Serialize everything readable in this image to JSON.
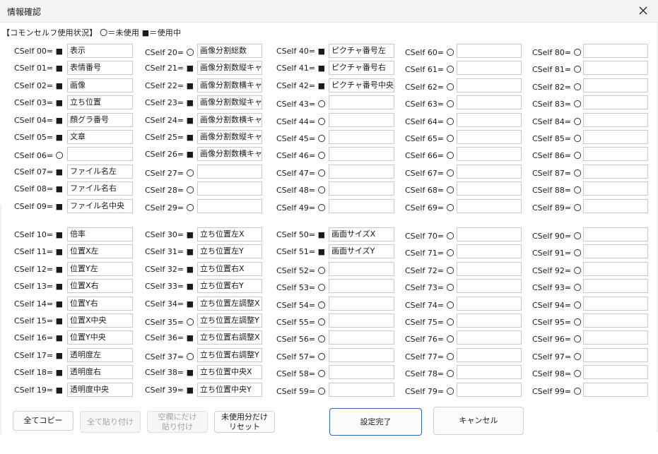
{
  "window": {
    "title": "情報確認",
    "close_icon": "close-icon"
  },
  "legend": "【コモンセルフ使用状況】 〇＝未使用 ■＝使用中",
  "slots": [
    {
      "label": "CSelf 00= ■",
      "value": "表示"
    },
    {
      "label": "CSelf 01= ■",
      "value": "表情番号"
    },
    {
      "label": "CSelf 02= ■",
      "value": "画像"
    },
    {
      "label": "CSelf 03= ■",
      "value": "立ち位置"
    },
    {
      "label": "CSelf 04= ■",
      "value": "顔グラ番号"
    },
    {
      "label": "CSelf 05= ■",
      "value": "文章"
    },
    {
      "label": "CSelf 06= 〇",
      "value": ""
    },
    {
      "label": "CSelf 07= ■",
      "value": "ファイル名左"
    },
    {
      "label": "CSelf 08= ■",
      "value": "ファイル名右"
    },
    {
      "label": "CSelf 09= ■",
      "value": "ファイル名中央"
    },
    {
      "label": "CSelf 10= ■",
      "value": "倍率"
    },
    {
      "label": "CSelf 11= ■",
      "value": "位置X左"
    },
    {
      "label": "CSelf 12= ■",
      "value": "位置Y左"
    },
    {
      "label": "CSelf 13= ■",
      "value": "位置X右"
    },
    {
      "label": "CSelf 14= ■",
      "value": "位置Y右"
    },
    {
      "label": "CSelf 15= ■",
      "value": "位置X中央"
    },
    {
      "label": "CSelf 16= ■",
      "value": "位置Y中央"
    },
    {
      "label": "CSelf 17= ■",
      "value": "透明度左"
    },
    {
      "label": "CSelf 18= ■",
      "value": "透明度右"
    },
    {
      "label": "CSelf 19= ■",
      "value": "透明度中央"
    },
    {
      "label": "CSelf 20= 〇",
      "value": "画像分割総数"
    },
    {
      "label": "CSelf 21= ■",
      "value": "画像分割数縦キャラ"
    },
    {
      "label": "CSelf 22= ■",
      "value": "画像分割数横キャラ"
    },
    {
      "label": "CSelf 23= ■",
      "value": "画像分割数縦キャラ"
    },
    {
      "label": "CSelf 24= ■",
      "value": "画像分割数横キャラ"
    },
    {
      "label": "CSelf 25= ■",
      "value": "画像分割数縦キャラ"
    },
    {
      "label": "CSelf 26= ■",
      "value": "画像分割数横キャラ"
    },
    {
      "label": "CSelf 27= 〇",
      "value": ""
    },
    {
      "label": "CSelf 28= 〇",
      "value": ""
    },
    {
      "label": "CSelf 29= 〇",
      "value": ""
    },
    {
      "label": "CSelf 30= ■",
      "value": "立ち位置左X"
    },
    {
      "label": "CSelf 31= ■",
      "value": "立ち位置左Y"
    },
    {
      "label": "CSelf 32= ■",
      "value": "立ち位置右X"
    },
    {
      "label": "CSelf 33= ■",
      "value": "立ち位置右Y"
    },
    {
      "label": "CSelf 34= ■",
      "value": "立ち位置左調整X"
    },
    {
      "label": "CSelf 35= 〇",
      "value": "立ち位置左調整Y"
    },
    {
      "label": "CSelf 36= ■",
      "value": "立ち位置右調整X"
    },
    {
      "label": "CSelf 37= 〇",
      "value": "立ち位置右調整Y"
    },
    {
      "label": "CSelf 38= ■",
      "value": "立ち位置中央X"
    },
    {
      "label": "CSelf 39= ■",
      "value": "立ち位置中央Y"
    },
    {
      "label": "CSelf 40= ■",
      "value": "ピクチャ番号左"
    },
    {
      "label": "CSelf 41= ■",
      "value": "ピクチャ番号右"
    },
    {
      "label": "CSelf 42= ■",
      "value": "ピクチャ番号中央"
    },
    {
      "label": "CSelf 43= 〇",
      "value": ""
    },
    {
      "label": "CSelf 44= 〇",
      "value": ""
    },
    {
      "label": "CSelf 45= 〇",
      "value": ""
    },
    {
      "label": "CSelf 46= 〇",
      "value": ""
    },
    {
      "label": "CSelf 47= 〇",
      "value": ""
    },
    {
      "label": "CSelf 48= 〇",
      "value": ""
    },
    {
      "label": "CSelf 49= 〇",
      "value": ""
    },
    {
      "label": "CSelf 50= ■",
      "value": "画面サイズX"
    },
    {
      "label": "CSelf 51= ■",
      "value": "画面サイズY"
    },
    {
      "label": "CSelf 52= 〇",
      "value": ""
    },
    {
      "label": "CSelf 53= 〇",
      "value": ""
    },
    {
      "label": "CSelf 54= 〇",
      "value": ""
    },
    {
      "label": "CSelf 55= 〇",
      "value": ""
    },
    {
      "label": "CSelf 56= 〇",
      "value": ""
    },
    {
      "label": "CSelf 57= 〇",
      "value": ""
    },
    {
      "label": "CSelf 58= 〇",
      "value": ""
    },
    {
      "label": "CSelf 59= 〇",
      "value": ""
    },
    {
      "label": "CSelf 60= 〇",
      "value": ""
    },
    {
      "label": "CSelf 61= 〇",
      "value": ""
    },
    {
      "label": "CSelf 62= 〇",
      "value": ""
    },
    {
      "label": "CSelf 63= 〇",
      "value": ""
    },
    {
      "label": "CSelf 64= 〇",
      "value": ""
    },
    {
      "label": "CSelf 65= 〇",
      "value": ""
    },
    {
      "label": "CSelf 66= 〇",
      "value": ""
    },
    {
      "label": "CSelf 67= 〇",
      "value": ""
    },
    {
      "label": "CSelf 68= 〇",
      "value": ""
    },
    {
      "label": "CSelf 69= 〇",
      "value": ""
    },
    {
      "label": "CSelf 70= 〇",
      "value": ""
    },
    {
      "label": "CSelf 71= 〇",
      "value": ""
    },
    {
      "label": "CSelf 72= 〇",
      "value": ""
    },
    {
      "label": "CSelf 73= 〇",
      "value": ""
    },
    {
      "label": "CSelf 74= 〇",
      "value": ""
    },
    {
      "label": "CSelf 75= 〇",
      "value": ""
    },
    {
      "label": "CSelf 76= 〇",
      "value": ""
    },
    {
      "label": "CSelf 77= 〇",
      "value": ""
    },
    {
      "label": "CSelf 78= 〇",
      "value": ""
    },
    {
      "label": "CSelf 79= 〇",
      "value": ""
    },
    {
      "label": "CSelf 80= 〇",
      "value": ""
    },
    {
      "label": "CSelf 81= 〇",
      "value": ""
    },
    {
      "label": "CSelf 82= 〇",
      "value": ""
    },
    {
      "label": "CSelf 83= 〇",
      "value": ""
    },
    {
      "label": "CSelf 84= 〇",
      "value": ""
    },
    {
      "label": "CSelf 85= 〇",
      "value": ""
    },
    {
      "label": "CSelf 86= 〇",
      "value": ""
    },
    {
      "label": "CSelf 87= 〇",
      "value": ""
    },
    {
      "label": "CSelf 88= 〇",
      "value": ""
    },
    {
      "label": "CSelf 89= 〇",
      "value": ""
    },
    {
      "label": "CSelf 90= 〇",
      "value": ""
    },
    {
      "label": "CSelf 91= 〇",
      "value": ""
    },
    {
      "label": "CSelf 92= 〇",
      "value": ""
    },
    {
      "label": "CSelf 93= 〇",
      "value": ""
    },
    {
      "label": "CSelf 94= 〇",
      "value": ""
    },
    {
      "label": "CSelf 95= 〇",
      "value": ""
    },
    {
      "label": "CSelf 96= 〇",
      "value": ""
    },
    {
      "label": "CSelf 97= 〇",
      "value": ""
    },
    {
      "label": "CSelf 98= 〇",
      "value": ""
    },
    {
      "label": "CSelf 99= 〇",
      "value": ""
    }
  ],
  "buttons": {
    "copy_all": "全てコピー",
    "paste_all": "全て貼り付け",
    "paste_blank_line1": "空欄にだけ",
    "paste_blank_line2": "貼り付け",
    "reset_unused_line1": "未使用分だけ",
    "reset_unused_line2": "リセット",
    "ok": "設定完了",
    "cancel": "キャンセル"
  },
  "colors": {
    "titlebar": "#f3f3f3",
    "input_border": "#c9c9c9",
    "primary_border": "#2a66c8"
  }
}
